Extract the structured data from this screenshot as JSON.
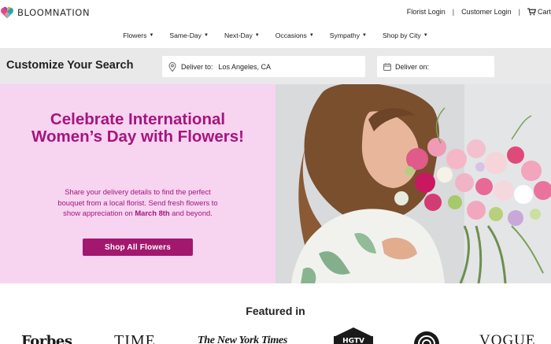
{
  "header": {
    "brand": "BLOOMNATION",
    "links": [
      "Florist Login",
      "Customer Login"
    ],
    "cart_label": "Cart"
  },
  "nav": {
    "items": [
      {
        "label": "Flowers"
      },
      {
        "label": "Same-Day"
      },
      {
        "label": "Next-Day"
      },
      {
        "label": "Occasions"
      },
      {
        "label": "Sympathy"
      },
      {
        "label": "Shop by City"
      }
    ]
  },
  "search": {
    "title": "Customize Your Search",
    "deliver_to_label": "Deliver to:",
    "deliver_to_value": "Los Angeles, CA",
    "deliver_on_label": "Deliver on:"
  },
  "hero": {
    "title": "Celebrate International Women’s Day with Flowers!",
    "desc_part1": "Share your delivery details to find the perfect bouquet from a local florist. Send fresh flowers to show appreciation on ",
    "desc_bold": "March 8th",
    "desc_part2": " and beyond.",
    "button_label": "Shop All Flowers"
  },
  "featured": {
    "title": "Featured in",
    "logos": [
      "Forbes",
      "TIME",
      "The New York Times",
      "HGTV",
      "TODAY",
      "VOGUE"
    ]
  },
  "colors": {
    "hero_bg": "#f7d4f0",
    "brand_magenta": "#a5157f",
    "button_bg": "#a3186f",
    "search_band": "#e9e9e9"
  },
  "icons": [
    "bloomnation-logo-icon",
    "cart-icon",
    "chevron-down-icon",
    "location-pin-icon",
    "calendar-icon"
  ]
}
